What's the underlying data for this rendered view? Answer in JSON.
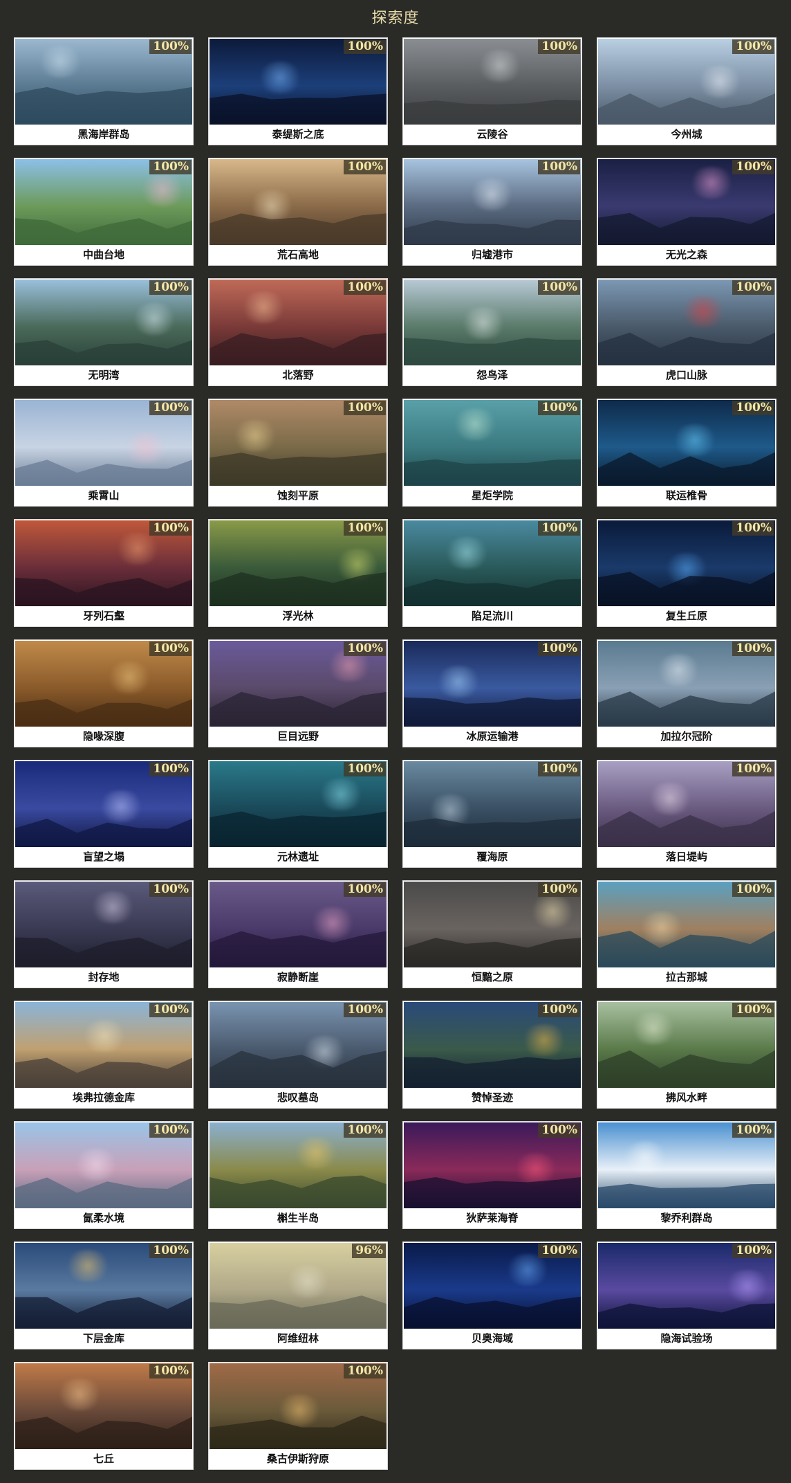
{
  "page": {
    "title": "探索度"
  },
  "regions": [
    {
      "name": "黑海岸群岛",
      "progress": "100%",
      "sky": "#9bb8d0",
      "mid": "#5a7a92",
      "ground": "#2e4a5e",
      "accent": "#cfe3f0"
    },
    {
      "name": "泰缇斯之底",
      "progress": "100%",
      "sky": "#0d1a3a",
      "mid": "#1c3f7a",
      "ground": "#0a1228",
      "accent": "#7ab8ff"
    },
    {
      "name": "云陵谷",
      "progress": "100%",
      "sky": "#8a8e92",
      "mid": "#5a5d60",
      "ground": "#3a3c3e",
      "accent": "#d8dcdf"
    },
    {
      "name": "今州城",
      "progress": "100%",
      "sky": "#b9cfe2",
      "mid": "#7c8fa4",
      "ground": "#4a5868",
      "accent": "#eef4fa"
    },
    {
      "name": "中曲台地",
      "progress": "100%",
      "sky": "#8cc0e8",
      "mid": "#6c9a5a",
      "ground": "#3f6a3a",
      "accent": "#f2b8d0"
    },
    {
      "name": "荒石高地",
      "progress": "100%",
      "sky": "#d8b88a",
      "mid": "#8a6a48",
      "ground": "#4a3a2a",
      "accent": "#f5e4c0"
    },
    {
      "name": "归墟港市",
      "progress": "100%",
      "sky": "#a8c4e0",
      "mid": "#5a6a80",
      "ground": "#2f3a4a",
      "accent": "#e8f0fa"
    },
    {
      "name": "无光之森",
      "progress": "100%",
      "sky": "#1a2044",
      "mid": "#3a3a70",
      "ground": "#141a30",
      "accent": "#f0a0d8"
    },
    {
      "name": "无明湾",
      "progress": "100%",
      "sky": "#9ac0dc",
      "mid": "#4a6a5a",
      "ground": "#2a4038",
      "accent": "#d8ecf4"
    },
    {
      "name": "北落野",
      "progress": "100%",
      "sky": "#c06a58",
      "mid": "#7a3a38",
      "ground": "#3a1e22",
      "accent": "#f5c098"
    },
    {
      "name": "怨鸟泽",
      "progress": "100%",
      "sky": "#b8cad6",
      "mid": "#5a7a6a",
      "ground": "#2e4a40",
      "accent": "#e8f0f0"
    },
    {
      "name": "虎口山脉",
      "progress": "100%",
      "sky": "#7c98b4",
      "mid": "#4a5a6a",
      "ground": "#263240",
      "accent": "#e04040"
    },
    {
      "name": "乘霄山",
      "progress": "100%",
      "sky": "#9ab4d4",
      "mid": "#c8d4e4",
      "ground": "#6a7c94",
      "accent": "#f0c0d0"
    },
    {
      "name": "蚀刻平原",
      "progress": "100%",
      "sky": "#b08a68",
      "mid": "#7a6a48",
      "ground": "#3e3a28",
      "accent": "#f0d898"
    },
    {
      "name": "星炬学院",
      "progress": "100%",
      "sky": "#5aa0a8",
      "mid": "#3a7a80",
      "ground": "#1e4448",
      "accent": "#c8ecd8"
    },
    {
      "name": "联运椎骨",
      "progress": "100%",
      "sky": "#0e2a4a",
      "mid": "#1e5a8a",
      "ground": "#0a1a2c",
      "accent": "#6ad0ff"
    },
    {
      "name": "牙列石壑",
      "progress": "100%",
      "sky": "#c0583a",
      "mid": "#6a2e3a",
      "ground": "#2a1420",
      "accent": "#f0a070"
    },
    {
      "name": "浮光林",
      "progress": "100%",
      "sky": "#8a9a48",
      "mid": "#3a5a3a",
      "ground": "#1e3020",
      "accent": "#d8e070"
    },
    {
      "name": "陷足流川",
      "progress": "100%",
      "sky": "#4a8aa0",
      "mid": "#2a5a5a",
      "ground": "#143030",
      "accent": "#a8e8f0"
    },
    {
      "name": "复生丘原",
      "progress": "100%",
      "sky": "#0a1a3a",
      "mid": "#1a3a6a",
      "ground": "#081224",
      "accent": "#5ab0ff"
    },
    {
      "name": "隐喙深腹",
      "progress": "100%",
      "sky": "#c08a4a",
      "mid": "#8a5a2a",
      "ground": "#4a2e14",
      "accent": "#f0c880"
    },
    {
      "name": "巨目远野",
      "progress": "100%",
      "sky": "#6a5a9a",
      "mid": "#5a4a6a",
      "ground": "#2a2434",
      "accent": "#f0a0b0"
    },
    {
      "name": "冰原运输港",
      "progress": "100%",
      "sky": "#1a2a5a",
      "mid": "#3a5aa0",
      "ground": "#101a38",
      "accent": "#a8d8ff"
    },
    {
      "name": "加拉尔冠阶",
      "progress": "100%",
      "sky": "#5a7a90",
      "mid": "#8aa0b4",
      "ground": "#2a3a48",
      "accent": "#e8f0f8"
    },
    {
      "name": "盲望之塌",
      "progress": "100%",
      "sky": "#1a2a7a",
      "mid": "#3a4aa0",
      "ground": "#101844",
      "accent": "#c0c8ff"
    },
    {
      "name": "元林遗址",
      "progress": "100%",
      "sky": "#2a7a8a",
      "mid": "#1a4a5a",
      "ground": "#0a2430",
      "accent": "#8ae0f0"
    },
    {
      "name": "覆海原",
      "progress": "100%",
      "sky": "#6a8aa0",
      "mid": "#3a5064",
      "ground": "#1e2c3a",
      "accent": "#c8dcea"
    },
    {
      "name": "落日堤屿",
      "progress": "100%",
      "sky": "#a8a0c4",
      "mid": "#6a5a80",
      "ground": "#3a3048",
      "accent": "#f0e0f0"
    },
    {
      "name": "封存地",
      "progress": "100%",
      "sky": "#5a5a7a",
      "mid": "#3a3a54",
      "ground": "#1e1e2c",
      "accent": "#d8d0e8"
    },
    {
      "name": "寂静断崖",
      "progress": "100%",
      "sky": "#6a5a8a",
      "mid": "#4a3a6a",
      "ground": "#24183a",
      "accent": "#f0a8c8"
    },
    {
      "name": "恒黯之原",
      "progress": "100%",
      "sky": "#4a4a4a",
      "mid": "#6a6460",
      "ground": "#2a2826",
      "accent": "#f0e0b0"
    },
    {
      "name": "拉古那城",
      "progress": "100%",
      "sky": "#5aa0c0",
      "mid": "#a08060",
      "ground": "#2a4a5a",
      "accent": "#f0d8a8"
    },
    {
      "name": "埃弗拉德金库",
      "progress": "100%",
      "sky": "#8ab4d8",
      "mid": "#c0a070",
      "ground": "#4a4038",
      "accent": "#f5e4b8"
    },
    {
      "name": "悲叹墓岛",
      "progress": "100%",
      "sky": "#7a94b0",
      "mid": "#4a5a6e",
      "ground": "#28323e",
      "accent": "#dce6f0"
    },
    {
      "name": "赞悼圣迹",
      "progress": "100%",
      "sky": "#2a4a7a",
      "mid": "#3a5a4a",
      "ground": "#142030",
      "accent": "#f0b848"
    },
    {
      "name": "拂风水畔",
      "progress": "100%",
      "sky": "#a8c0a0",
      "mid": "#5a7a4a",
      "ground": "#2e4028",
      "accent": "#e8f0d8"
    },
    {
      "name": "氤柔水境",
      "progress": "100%",
      "sky": "#9ac4e8",
      "mid": "#c8a0b8",
      "ground": "#5a6a80",
      "accent": "#f8e0f0"
    },
    {
      "name": "槲生半岛",
      "progress": "100%",
      "sky": "#8ab0d0",
      "mid": "#8a8a4a",
      "ground": "#3a4a2e",
      "accent": "#f0c860"
    },
    {
      "name": "狄萨莱海脊",
      "progress": "100%",
      "sky": "#3a1a5a",
      "mid": "#8a2a5a",
      "ground": "#1a1030",
      "accent": "#ff5a7a"
    },
    {
      "name": "黎乔利群岛",
      "progress": "100%",
      "sky": "#4a90d0",
      "mid": "#e8f0f8",
      "ground": "#2a4a6a",
      "accent": "#ffffff"
    },
    {
      "name": "下层金库",
      "progress": "100%",
      "sky": "#2a4a7a",
      "mid": "#5a7aa0",
      "ground": "#141e34",
      "accent": "#f0c870"
    },
    {
      "name": "阿维纽林",
      "progress": "96%",
      "sky": "#d8d0a0",
      "mid": "#b0a888",
      "ground": "#6a6a58",
      "accent": "#e8e4d0"
    },
    {
      "name": "贝奥海域",
      "progress": "100%",
      "sky": "#0a1a4a",
      "mid": "#1a3a8a",
      "ground": "#081030",
      "accent": "#6ab0ff"
    },
    {
      "name": "隐海试验场",
      "progress": "100%",
      "sky": "#1a2a6a",
      "mid": "#5a4aa0",
      "ground": "#0e1438",
      "accent": "#b8a0ff"
    },
    {
      "name": "七丘",
      "progress": "100%",
      "sky": "#c07a48",
      "mid": "#6a4a3a",
      "ground": "#2e2018",
      "accent": "#f8c890"
    },
    {
      "name": "桑古伊斯狩原",
      "progress": "100%",
      "sky": "#a06a48",
      "mid": "#6a5a3a",
      "ground": "#2e2818",
      "accent": "#f0c070"
    }
  ]
}
